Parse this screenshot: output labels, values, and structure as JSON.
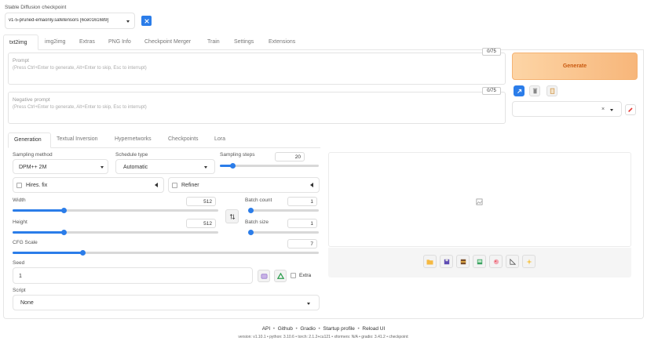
{
  "checkpoint": {
    "label": "Stable Diffusion checkpoint",
    "value": "v1-5-pruned-emaonly.safetensors [6ce0161689]"
  },
  "main_tabs": [
    "txt2img",
    "img2img",
    "Extras",
    "PNG Info",
    "Checkpoint Merger",
    "Train",
    "Settings",
    "Extensions"
  ],
  "prompt": {
    "label": "Prompt",
    "placeholder": "(Press Ctrl+Enter to generate, Alt+Enter to skip, Esc to interrupt)",
    "counter": "0/75"
  },
  "negative_prompt": {
    "label": "Negative prompt",
    "placeholder": "(Press Ctrl+Enter to generate, Alt+Enter to skip, Esc to interrupt)",
    "counter": "0/75"
  },
  "generate_label": "Generate",
  "sub_tabs": [
    "Generation",
    "Textual Inversion",
    "Hypernetworks",
    "Checkpoints",
    "Lora"
  ],
  "sampling_method": {
    "label": "Sampling method",
    "value": "DPM++ 2M"
  },
  "schedule_type": {
    "label": "Schedule type",
    "value": "Automatic"
  },
  "sampling_steps": {
    "label": "Sampling steps",
    "value": "20",
    "fraction": 0.13
  },
  "hires_fix": {
    "label": "Hires. fix"
  },
  "refiner": {
    "label": "Refiner"
  },
  "width": {
    "label": "Width",
    "value": "512",
    "fraction": 0.25
  },
  "height": {
    "label": "Height",
    "value": "512",
    "fraction": 0.25
  },
  "batch_count": {
    "label": "Batch count",
    "value": "1",
    "fraction": 0.0
  },
  "batch_size": {
    "label": "Batch size",
    "value": "1",
    "fraction": 0.0
  },
  "cfg_scale": {
    "label": "CFG Scale",
    "value": "7",
    "fraction": 0.23
  },
  "seed": {
    "label": "Seed",
    "value": "1",
    "extra_label": "Extra"
  },
  "script": {
    "label": "Script",
    "value": "None"
  },
  "footer": {
    "links": [
      "API",
      "Github",
      "Gradio",
      "Startup profile",
      "Reload UI"
    ],
    "versions": "version: v1.10.1  •  python: 3.10.6  •  torch: 2.1.2+cu121  •  xformers: N/A  •  gradio: 3.41.2  •  checkpoint:"
  },
  "colors": {
    "accent": "#2b7de9",
    "generate_start": "#fdd5a6",
    "generate_end": "#f7b67a",
    "generate_text": "#c9590f"
  }
}
